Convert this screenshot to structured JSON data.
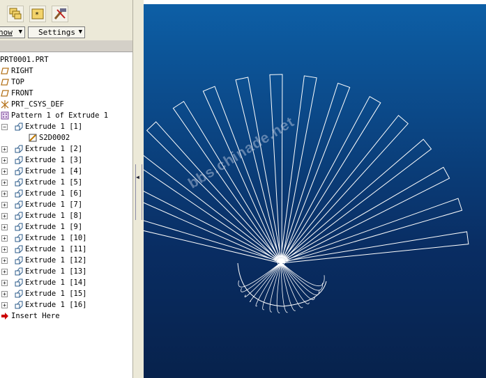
{
  "menus": {
    "show_label": "how",
    "settings_label": "Settings"
  },
  "tree": {
    "root": "PRT0001.PRT",
    "datums": [
      "RIGHT",
      "TOP",
      "FRONT"
    ],
    "csys": "PRT_CSYS_DEF",
    "pattern": "Pattern 1 of Extrude 1",
    "extrudes": [
      "Extrude 1 [1]",
      "Extrude 1 [2]",
      "Extrude 1 [3]",
      "Extrude 1 [4]",
      "Extrude 1 [5]",
      "Extrude 1 [6]",
      "Extrude 1 [7]",
      "Extrude 1 [8]",
      "Extrude 1 [9]",
      "Extrude 1 [10]",
      "Extrude 1 [11]",
      "Extrude 1 [12]",
      "Extrude 1 [13]",
      "Extrude 1 [14]",
      "Extrude 1 [15]",
      "Extrude 1 [16]"
    ],
    "sketch": "S2D0002",
    "insert_here": "Insert Here"
  },
  "watermark": "bbs.chinade.net",
  "colors": {
    "viewport_top": "#0d5fa6",
    "viewport_bottom": "#07224c",
    "geometry": "#ffffff",
    "insert_arrow": "#cc0000"
  }
}
